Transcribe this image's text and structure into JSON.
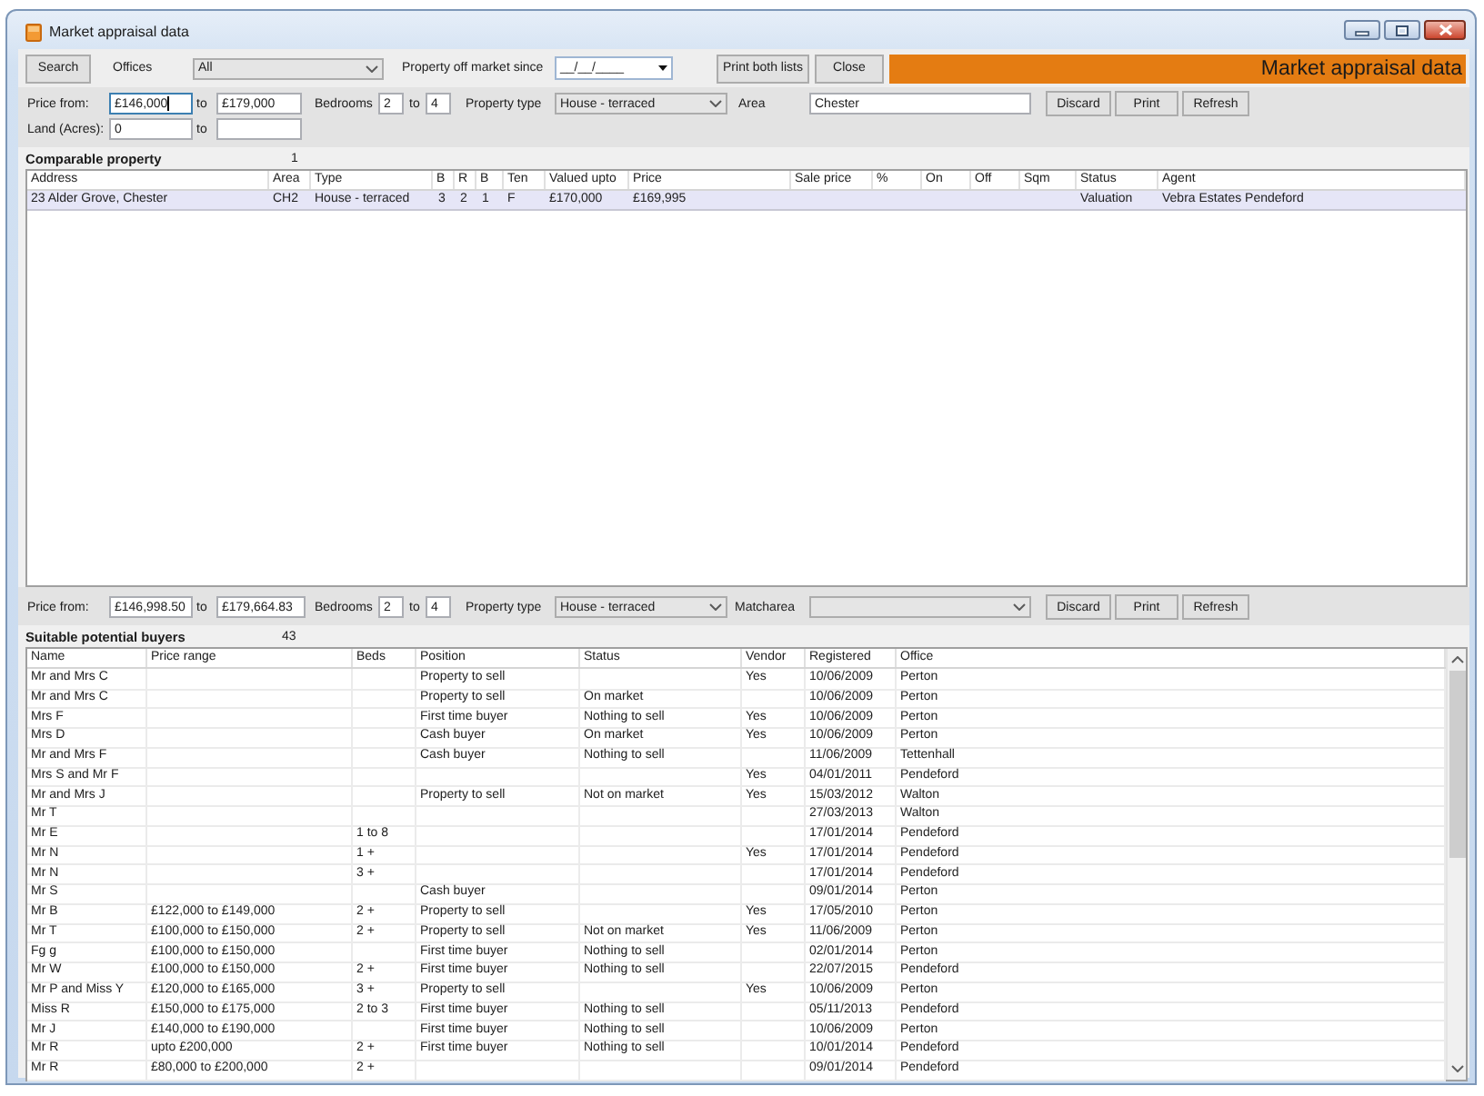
{
  "window": {
    "title": "Market appraisal data"
  },
  "toolbar": {
    "search_button": "Search",
    "offices_label": "Offices",
    "offices": {
      "value": "All",
      "focused": false
    },
    "off_market_label": "Property off market since",
    "off_market_date": {
      "value": "__/__/____",
      "focused": false
    },
    "buttons": [
      "Print both lists",
      "Close"
    ],
    "banner": "Market appraisal data"
  },
  "property_filter": {
    "price_label": "Price from:",
    "price_from": {
      "value": "£146,000",
      "focused": true
    },
    "price_to_label": "to",
    "price_to": {
      "value": "£179,000",
      "focused": false
    },
    "bedrooms_label": "Bedrooms",
    "bedrooms_from": {
      "value": "2",
      "focused": false
    },
    "bedrooms_to_label": "to",
    "bedrooms_to": {
      "value": "4",
      "focused": false
    },
    "property_type_label": "Property type",
    "property_type": {
      "value": "House - terraced",
      "focused": false
    },
    "area_label": "Area",
    "area": {
      "value": "Chester",
      "focused": false
    },
    "buttons": [
      "Discard",
      "Print",
      "Refresh"
    ],
    "land_label": "Land (Acres):",
    "land_from": {
      "value": "0",
      "focused": false
    },
    "land_to_label": "to",
    "land_to": {
      "focused": false
    }
  },
  "comparable": {
    "title": "Comparable property",
    "count": "1",
    "columns": [
      "Address",
      "Area",
      "Type",
      "B",
      "R",
      "B",
      "Ten",
      "Valued upto",
      "Price",
      "Sale price",
      "%",
      "On",
      "Off",
      "Sqm",
      "Status",
      "Agent"
    ],
    "rows": [
      {
        "address": "23 Alder Grove, Chester",
        "area": "CH2",
        "type": "House - terraced",
        "column_4": "3",
        "column_5": "2",
        "column_6": "1",
        "ten": "F",
        "valued_upto": "£170,000",
        "price": "£169,995",
        "status": "Valuation",
        "agent": "Vebra Estates Pendeford",
        "selected": true
      }
    ]
  },
  "buyer_filter": {
    "price_label": "Price from:",
    "price_from": {
      "value": "£146,998.50",
      "focused": false
    },
    "price_to_label": "to",
    "price_to": {
      "value": "£179,664.83",
      "focused": false
    },
    "bedrooms_label": "Bedrooms",
    "bedrooms_from": {
      "value": "2",
      "focused": false
    },
    "bedrooms_to_label": "to",
    "bedrooms_to": {
      "value": "4",
      "focused": false
    },
    "property_type_label": "Property type",
    "property_type": {
      "value": "House - terraced",
      "focused": false
    },
    "matcharea_label": "Matcharea",
    "matcharea": {
      "focused": false
    },
    "buttons": [
      "Discard",
      "Print",
      "Refresh"
    ]
  },
  "buyers": {
    "title": "Suitable potential buyers",
    "count": "43",
    "columns": [
      "Name",
      "Price range",
      "Beds",
      "Position",
      "Status",
      "Vendor",
      "Registered",
      "Office"
    ],
    "rows": [
      {
        "name": "Mr and Mrs C",
        "position": "Property to sell",
        "vendor": "Yes",
        "registered": "10/06/2009",
        "office": "Perton"
      },
      {
        "name": "Mr and Mrs C",
        "position": "Property to sell",
        "status": "On market",
        "registered": "10/06/2009",
        "office": "Perton"
      },
      {
        "name": "Mrs F",
        "position": "First time buyer",
        "status": "Nothing to sell",
        "vendor": "Yes",
        "registered": "10/06/2009",
        "office": "Perton"
      },
      {
        "name": "Mrs D",
        "position": "Cash buyer",
        "status": "On market",
        "vendor": "Yes",
        "registered": "10/06/2009",
        "office": "Perton"
      },
      {
        "name": "Mr and Mrs F",
        "position": "Cash buyer",
        "status": "Nothing to sell",
        "registered": "11/06/2009",
        "office": "Tettenhall"
      },
      {
        "name": "Mrs S and Mr F",
        "vendor": "Yes",
        "registered": "04/01/2011",
        "office": "Pendeford"
      },
      {
        "name": "Mr and Mrs J",
        "position": "Property to sell",
        "status": "Not on market",
        "vendor": "Yes",
        "registered": "15/03/2012",
        "office": "Walton"
      },
      {
        "name": "Mr T",
        "registered": "27/03/2013",
        "office": "Walton"
      },
      {
        "name": "Mr E",
        "beds": "1 to 8",
        "registered": "17/01/2014",
        "office": "Pendeford"
      },
      {
        "name": "Mr N",
        "beds": "1 +",
        "vendor": "Yes",
        "registered": "17/01/2014",
        "office": "Pendeford"
      },
      {
        "name": "Mr N",
        "beds": "3 +",
        "registered": "17/01/2014",
        "office": "Pendeford"
      },
      {
        "name": "Mr S",
        "position": "Cash buyer",
        "registered": "09/01/2014",
        "office": "Perton"
      },
      {
        "name": "Mr B",
        "price_range": "£122,000 to £149,000",
        "beds": "2 +",
        "position": "Property to sell",
        "vendor": "Yes",
        "registered": "17/05/2010",
        "office": "Perton"
      },
      {
        "name": "Mr T",
        "price_range": "£100,000 to £150,000",
        "beds": "2 +",
        "position": "Property to sell",
        "status": "Not on market",
        "vendor": "Yes",
        "registered": "11/06/2009",
        "office": "Perton"
      },
      {
        "name": "Fg g",
        "price_range": "£100,000 to £150,000",
        "position": "First time buyer",
        "status": "Nothing to sell",
        "registered": "02/01/2014",
        "office": "Perton"
      },
      {
        "name": "Mr W",
        "price_range": "£100,000 to £150,000",
        "beds": "2 +",
        "position": "First time buyer",
        "status": "Nothing to sell",
        "registered": "22/07/2015",
        "office": "Pendeford"
      },
      {
        "name": "Mr P and Miss Y",
        "price_range": "£120,000 to £165,000",
        "beds": "3 +",
        "position": "Property to sell",
        "vendor": "Yes",
        "registered": "10/06/2009",
        "office": "Perton"
      },
      {
        "name": "Miss R",
        "price_range": "£150,000 to £175,000",
        "beds": "2 to 3",
        "position": "First time buyer",
        "status": "Nothing to sell",
        "registered": "05/11/2013",
        "office": "Pendeford"
      },
      {
        "name": "Mr J",
        "price_range": "£140,000 to £190,000",
        "position": "First time buyer",
        "status": "Nothing to sell",
        "registered": "10/06/2009",
        "office": "Perton"
      },
      {
        "name": "Mr R",
        "price_range": "upto £200,000",
        "beds": "2 +",
        "position": "First time buyer",
        "status": "Nothing to sell",
        "registered": "10/01/2014",
        "office": "Pendeford"
      },
      {
        "name": "Mr R",
        "price_range": "£80,000 to £200,000",
        "beds": "2 +",
        "registered": "09/01/2014",
        "office": "Pendeford"
      }
    ]
  }
}
